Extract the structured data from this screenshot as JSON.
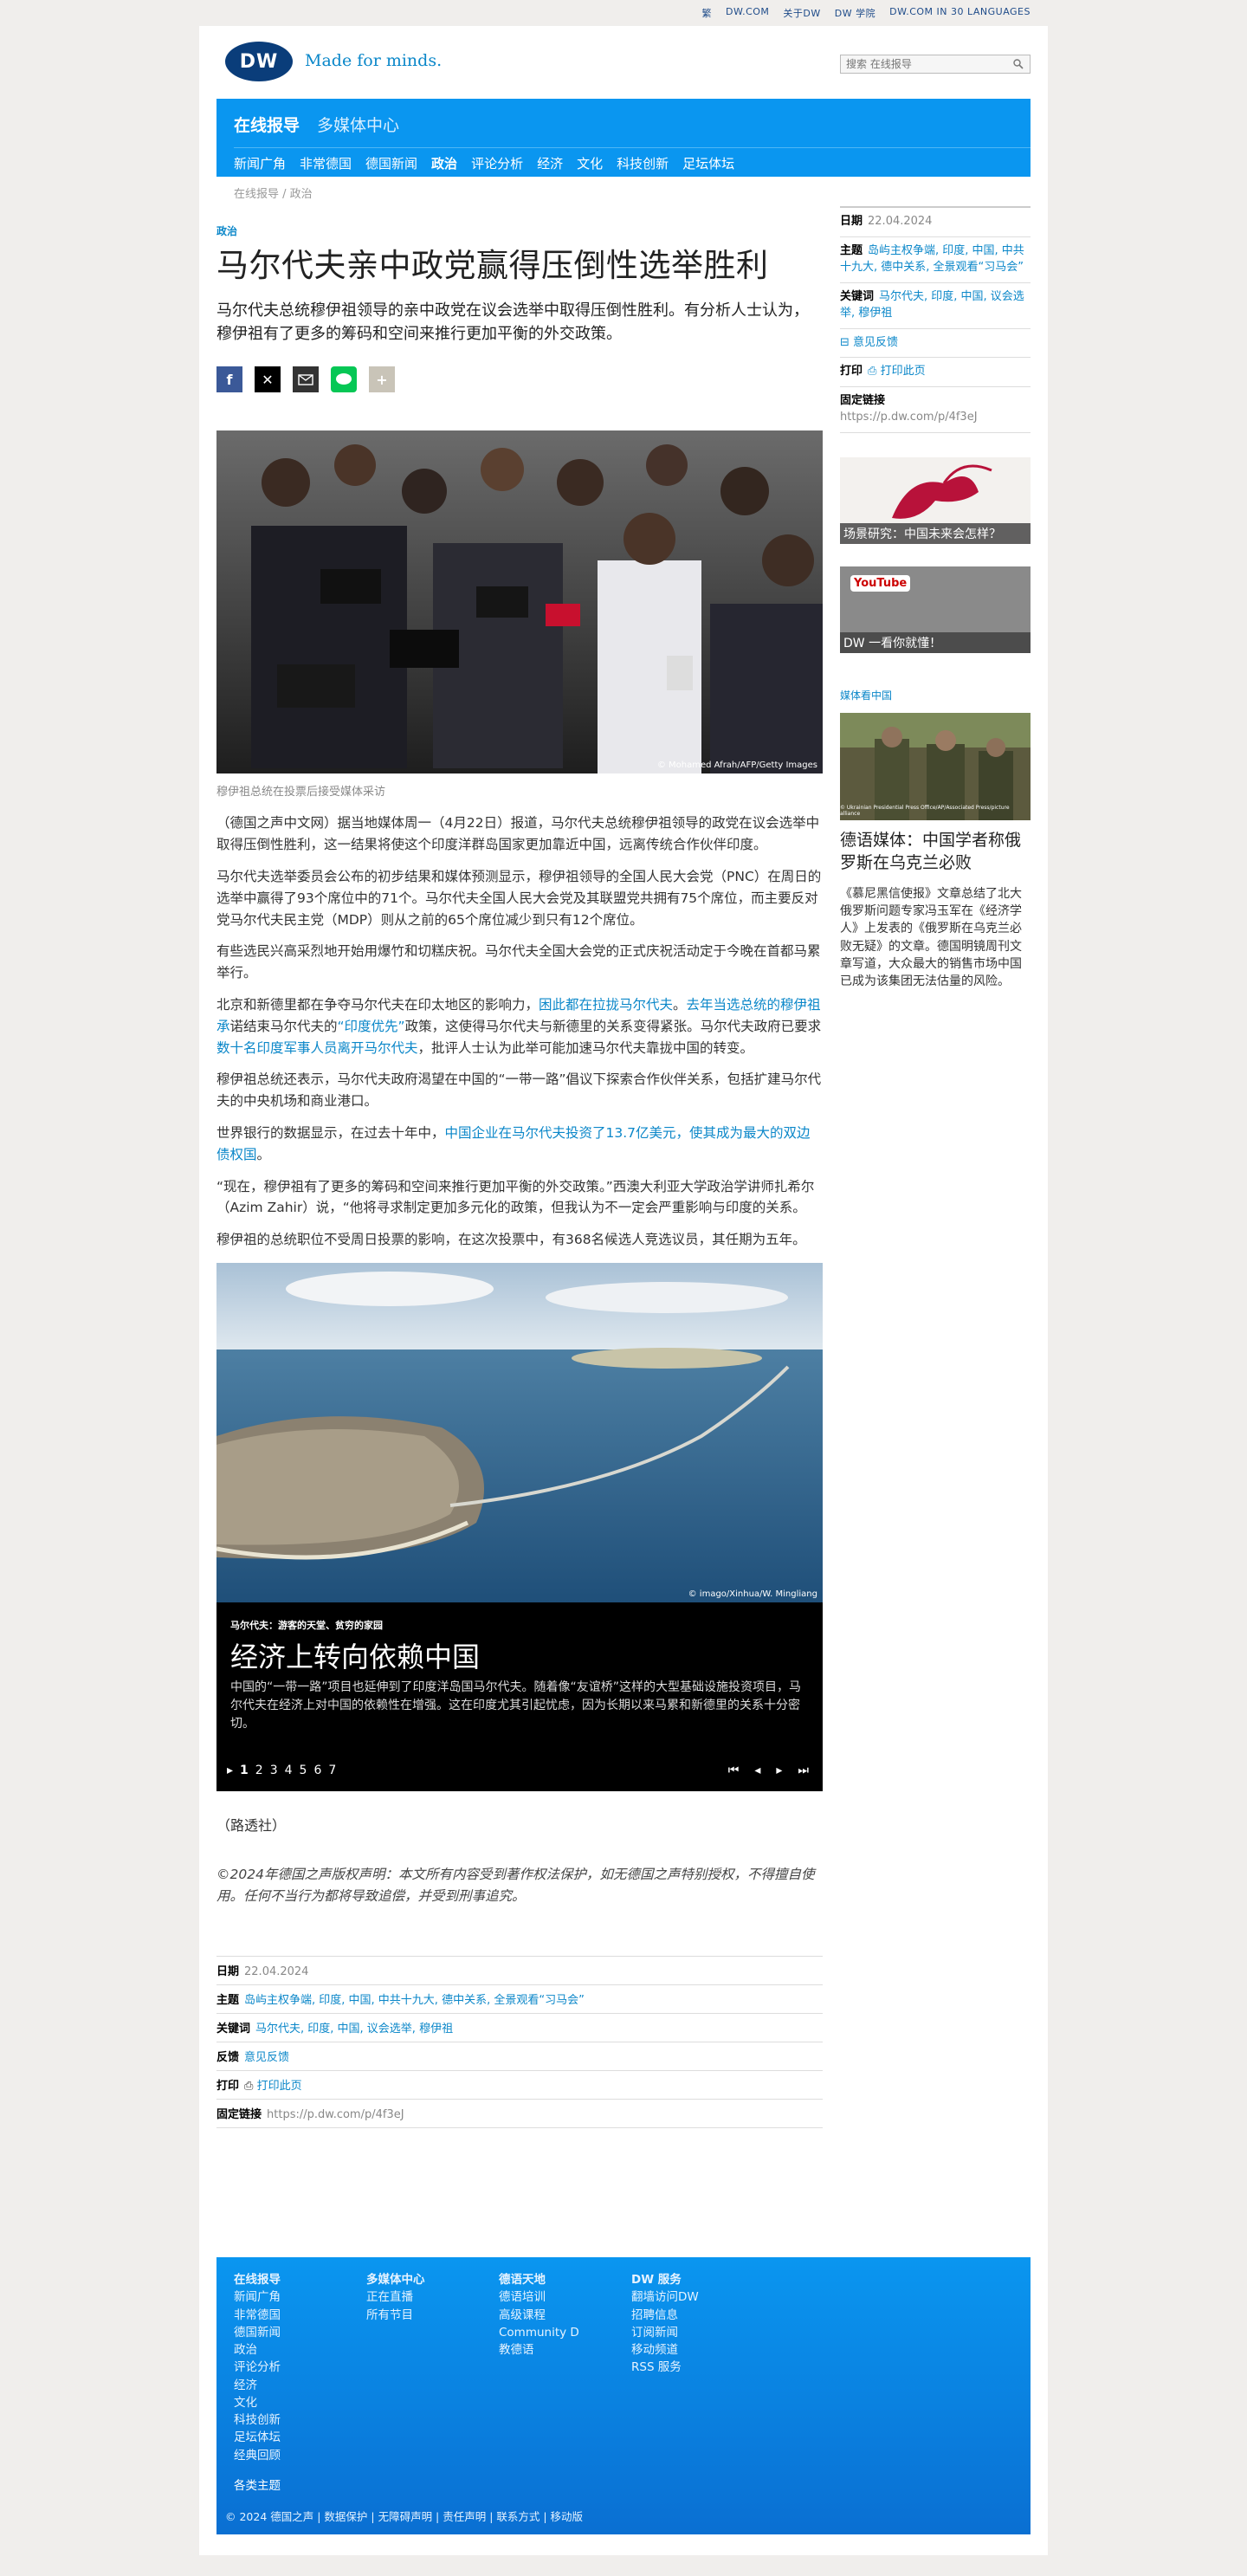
{
  "toplinks": [
    "繁",
    "DW.COM",
    "关于DW",
    "DW 学院",
    "DW.COM IN 30 LANGUAGES"
  ],
  "header": {
    "logo": "DW",
    "slogan": "Made for minds.",
    "search_placeholder": "搜索 在线报导"
  },
  "nav": {
    "top": [
      "在线报导",
      "多媒体中心"
    ],
    "sub": [
      "新闻广角",
      "非常德国",
      "德国新闻",
      "政治",
      "评论分析",
      "经济",
      "文化",
      "科技创新",
      "足坛体坛"
    ],
    "active_index": 3
  },
  "breadcrumb": "在线报导 / 政治",
  "article": {
    "kicker": "政治",
    "title": "马尔代夫亲中政党赢得压倒性选举胜利",
    "lead": "马尔代夫总统穆伊祖领导的亲中政党在议会选举中取得压倒性胜利。有分析人士认为，穆伊祖有了更多的筹码和空间来推行更加平衡的外交政策。",
    "share_icons": [
      "facebook-icon",
      "x-icon",
      "email-icon",
      "line-icon",
      "plus-icon"
    ],
    "photo_credit": "© Mohamed Afrah/AFP/Getty Images",
    "photo_caption": "穆伊祖总统在投票后接受媒体采访",
    "paragraphs": [
      [
        "（德国之声中文网）据当地媒体周一（4月22日）报道，马尔代夫总统穆伊祖领导的政党在议会选举中取得压倒性胜利，这一结果将使这个印度洋群岛国家更加靠近中国，远离传统合作伙伴印度。"
      ],
      [
        "马尔代夫选举委员会公布的初步结果和媒体预测显示，穆伊祖领导的全国人民大会党（PNC）在周日的选举中赢得了93个席位中的71个。马尔代夫全国人民大会党及其联盟党共拥有75个席位，而主要反对党马尔代夫民主党（MDP）则从之前的65个席位减少到只有12个席位。"
      ],
      [
        "有些选民兴高采烈地开始用爆竹和切糕庆祝。马尔代夫全国大会党的正式庆祝活动定于今晚在首都马累举行。"
      ],
      [
        "北京和新德里都在争夺马尔代夫在印太地区的影响力，",
        {
          "link": "困此都在拉拢马尔代夫"
        },
        "。",
        {
          "link": "去年当选总统的穆伊祖承"
        },
        "诺结束马尔代夫的",
        {
          "link": "“印度优先”"
        },
        "政策，这使得马尔代夫与新德里的关系变得紧张。马尔代夫政府已要求",
        {
          "link": "数十名印度军事人员离开马尔代夫"
        },
        "，批评人士认为此举可能加速马尔代夫靠拢中国的转变。"
      ],
      [
        "穆伊祖总统还表示，马尔代夫政府渴望在中国的“一带一路”倡议下探索合作伙伴关系，包括扩建马尔代夫的中央机场和商业港口。"
      ],
      [
        "世界银行的数据显示，在过去十年中，",
        {
          "link": "中国企业在马尔代夫投资了13.7亿美元，使其成为最大的双边债权国"
        },
        "。"
      ],
      [
        "“现在，穆伊祖有了更多的筹码和空间来推行更加平衡的外交政策。”西澳大利亚大学政治学讲师扎希尔（Azim Zahir）说，“他将寻求制定更加多元化的政策，但我认为不一定会严重影响与印度的关系。"
      ],
      [
        "穆伊祖的总统职位不受周日投票的影响，在这次投票中，有368名候选人竞选议员，其任期为五年。"
      ]
    ],
    "gallery": {
      "credit": "© imago/Xinhua/W. Mingliang",
      "kicker": "马尔代夫：游客的天堂、贫穷的家园",
      "title": "经济上转向依赖中国",
      "desc": "中国的“一带一路”项目也延伸到了印度洋岛国马尔代夫。随着像“友谊桥”这样的大型基础设施投资项目，马尔代夫在经济上对中国的依赖性在增强。这在印度尤其引起忧虑，因为长期以来马累和新德里的关系十分密切。",
      "pages": [
        "1",
        "2",
        "3",
        "4",
        "5",
        "6",
        "7"
      ],
      "current": 0
    },
    "source": "（路透社）",
    "copyright": "©2024年德国之声版权声明：本文所有内容受到著作权法保护，如无德国之声特别授权，不得擅自使用。任何不当行为都将导致追偿，并受到刑事追究。"
  },
  "meta": {
    "date_label": "日期",
    "date": "22.04.2024",
    "topics_label": "主题",
    "topics": "岛屿主权争端, 印度, 中国, 中共十九大, 德中关系, 全景观看“习马会”",
    "keywords_label": "关键词",
    "keywords": "马尔代夫, 印度, 中国, 议会选举, 穆伊祖",
    "feedback_label": "反馈",
    "feedback": "意见反馈",
    "print_label": "打印",
    "print": "打印此页",
    "permalink_label": "固定链接",
    "permalink": "https://p.dw.com/p/4f3eJ"
  },
  "sidebar": {
    "date_label": "日期",
    "date": "22.04.2024",
    "topics_label": "主题",
    "topics": "岛屿主权争端, 印度, 中国, 中共十九大, 德中关系, 全景观看“习马会”",
    "keywords_label": "关键词",
    "keywords": "马尔代夫, 印度, 中国, 议会选举, 穆伊祖",
    "feedback": "意见反馈",
    "print_label": "打印",
    "print": "打印此页",
    "permalink_label": "固定链接",
    "permalink": "https://p.dw.com/p/4f3eJ",
    "teaser1": "场景研究：中国未来会怎样？",
    "teaser2": "DW 一看你就懂！",
    "youtube": "YouTube",
    "kicker": "媒体看中国",
    "img_credit": "© Ukrainian Presidential Press Office/AP/Associated Press/picture alliance",
    "title": "德语媒体：中国学者称俄罗斯在乌克兰必败",
    "desc": "《慕尼黑信使报》文章总结了北大俄罗斯问题专家冯玉军在《经济学人》上发表的《俄罗斯在乌克兰必败无疑》的文章。德国明镜周刊文章写道，大众最大的销售市场中国已成为该集团无法估量的风险。"
  },
  "footer": {
    "cols": [
      {
        "head": "在线报导",
        "items": [
          "新闻广角",
          "非常德国",
          "德国新闻",
          "政治",
          "评论分析",
          "经济",
          "文化",
          "科技创新",
          "足坛体坛",
          "经典回顾"
        ]
      },
      {
        "head": "多媒体中心",
        "items": [
          "正在直播",
          "所有节目"
        ]
      },
      {
        "head": "德语天地",
        "items": [
          "德语培训",
          "高级课程",
          "Community D",
          "教德语"
        ]
      },
      {
        "head": "DW 服务",
        "items": [
          "翻墙访问DW",
          "招聘信息",
          "订阅新闻",
          "移动频道",
          "RSS 服务"
        ]
      }
    ],
    "topics": "各类主题",
    "bottom": "© 2024 德国之声 | 数据保护 | 无障碍声明 | 责任声明 | 联系方式 | 移动版"
  },
  "colors": {
    "brand_blue": "#0a96f0",
    "link": "#0b87c9",
    "dw_navy": "#0a3d7a"
  }
}
